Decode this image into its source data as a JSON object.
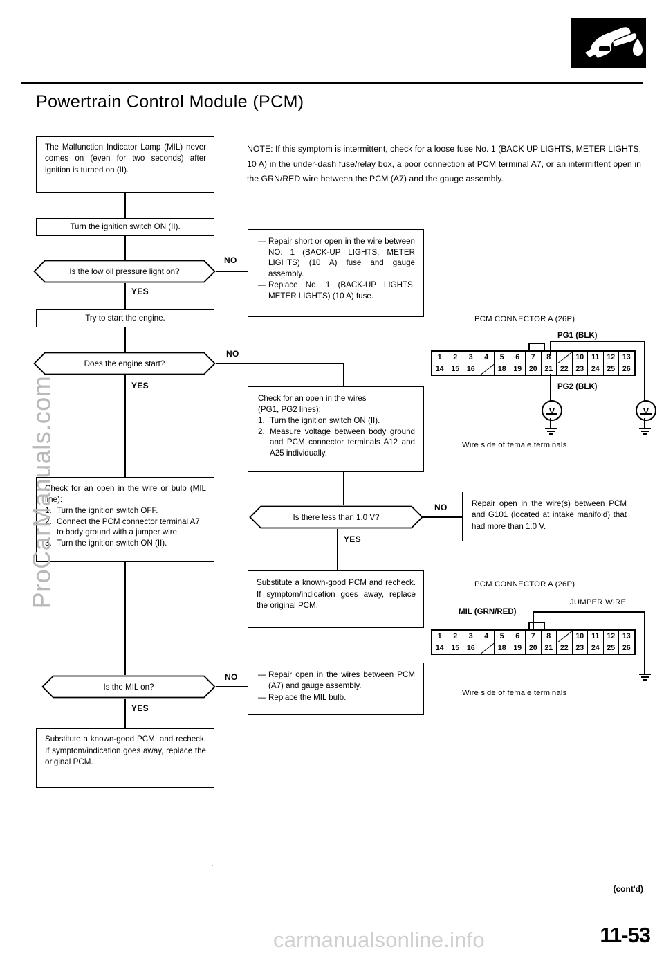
{
  "header": {
    "title": "Powertrain Control Module (PCM)",
    "logo_icon": "fuel-nozzle-icon"
  },
  "note": {
    "text": "NOTE:  If this symptom is intermittent, check for a loose fuse No. 1 (BACK UP LIGHTS, METER LIGHTS, 10 A) in the under-dash fuse/relay box, a poor connection at PCM terminal A7, or an intermittent open in the GRN/RED wire between the PCM (A7) and the gauge assembly."
  },
  "flow": {
    "symptom": "The Malfunction Indicator Lamp (MIL) never comes on (even for two seconds) after ignition is turned on (II).",
    "step_ignition_on": "Turn the ignition switch ON (II).",
    "decision_oil_light": "Is the low oil pressure light on?",
    "step_try_start": "Try to start the engine.",
    "decision_engine_start": "Does the engine start?",
    "check_mil_line": {
      "lead": "Check for an open in the wire or bulb (MIL line):",
      "steps": [
        {
          "num": "1.",
          "text": "Turn the ignition switch OFF."
        },
        {
          "num": "2.",
          "text": "Connect the PCM connector terminal A7 to body ground with a jumper wire."
        },
        {
          "num": "3.",
          "text": "Turn the ignition switch ON (II)."
        }
      ]
    },
    "decision_mil_on": "Is the MIL on?",
    "substitute_pcm_bottom": "Substitute a known-good PCM, and recheck. If symptom/indication goes away, replace the original PCM.",
    "check_pg_lines": {
      "lead1": "Check for an open in the wires",
      "lead2": "(PG1, PG2 lines):",
      "steps": [
        {
          "num": "1.",
          "text": "Turn the ignition switch ON (II)."
        },
        {
          "num": "2.",
          "text": "Measure voltage between body ground and PCM connector terminals A12 and A25 individually."
        }
      ]
    },
    "decision_less_than_1v": "Is there less than 1.0 V?",
    "substitute_pcm_middle": "Substitute a known-good PCM and recheck. If symptom/indication goes away, replace the original PCM.",
    "labels": {
      "yes": "YES",
      "no": "NO"
    }
  },
  "outcomes": {
    "fuse_repair": [
      "Repair short or open in the wire between NO. 1 (BACK-UP LIGHTS, METER LIGHTS) (10 A) fuse and gauge assembly.",
      "Replace No. 1 (BACK-UP LIGHTS, METER LIGHTS) (10 A) fuse."
    ],
    "g101_repair": "Repair open in the wire(s) between PCM and G101 (located at intake manifold) that had more than 1.0 V.",
    "mil_wire_repair": [
      "Repair open in the wires between PCM (A7) and gauge assembly.",
      "Replace the MIL bulb."
    ]
  },
  "connector_top": {
    "title": "PCM CONNECTOR A (26P)",
    "caption": "Wire side of female terminals",
    "label_pg1": "PG1 (BLK)",
    "label_pg2": "PG2 (BLK)",
    "row_top": [
      "1",
      "2",
      "3",
      "4",
      "5",
      "6",
      "7",
      "8",
      "",
      "10",
      "11",
      "12",
      "13"
    ],
    "row_bottom": [
      "14",
      "15",
      "16",
      "",
      "18",
      "19",
      "20",
      "21",
      "22",
      "23",
      "24",
      "25",
      "26"
    ],
    "meter_symbol": "V"
  },
  "connector_bottom": {
    "title": "PCM CONNECTOR A (26P)",
    "caption": "Wire side of female terminals",
    "label_mil": "MIL (GRN/RED)",
    "label_jumper": "JUMPER WIRE",
    "row_top": [
      "1",
      "2",
      "3",
      "4",
      "5",
      "6",
      "7",
      "8",
      "",
      "10",
      "11",
      "12",
      "13"
    ],
    "row_bottom": [
      "14",
      "15",
      "16",
      "",
      "18",
      "19",
      "20",
      "21",
      "22",
      "23",
      "24",
      "25",
      "26"
    ]
  },
  "footer": {
    "contd": "(cont'd)",
    "page_number": "11-53"
  },
  "watermarks": {
    "left": "ProCarManuals.com",
    "bottom": "carmanualsonline.info"
  }
}
